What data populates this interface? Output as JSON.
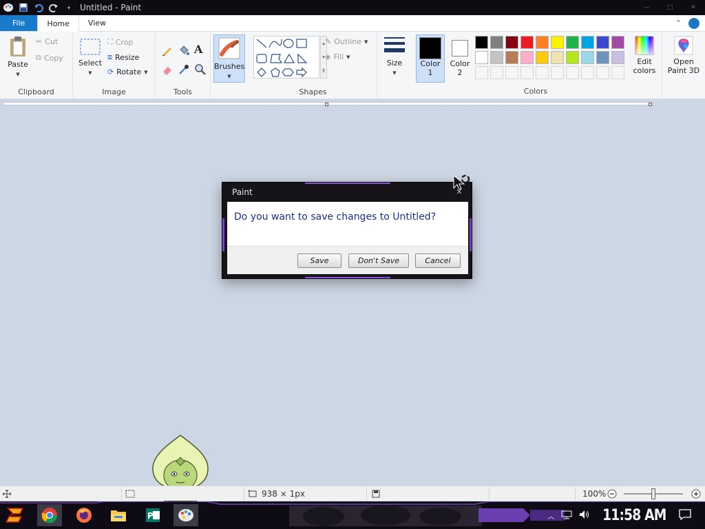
{
  "window": {
    "title": "Untitled - Paint",
    "controls": {
      "minimize": "—",
      "maximize": "□",
      "close": "✕"
    }
  },
  "tabs": {
    "file": "File",
    "home": "Home",
    "view": "View"
  },
  "ribbon": {
    "clipboard": {
      "paste": "Paste",
      "cut": "Cut",
      "copy": "Copy",
      "label": "Clipboard"
    },
    "image": {
      "select": "Select",
      "crop": "Crop",
      "resize": "Resize",
      "rotate": "Rotate",
      "label": "Image"
    },
    "tools": {
      "label": "Tools",
      "text_tool": "A"
    },
    "brushes": {
      "label": "Brushes"
    },
    "shapes": {
      "outline": "Outline",
      "fill": "Fill",
      "label": "Shapes"
    },
    "size": {
      "label": "Size"
    },
    "color1": {
      "line1": "Color",
      "line2": "1",
      "value": "#000000"
    },
    "color2": {
      "line1": "Color",
      "line2": "2",
      "value": "#ffffff"
    },
    "colors": {
      "label": "Colors",
      "palette_row1": [
        "#000000",
        "#7f7f7f",
        "#880015",
        "#ed1c24",
        "#ff7f27",
        "#fff200",
        "#22b14c",
        "#00a2e8",
        "#3f48cc",
        "#a349a4"
      ],
      "palette_row2": [
        "#ffffff",
        "#c3c3c3",
        "#b97a57",
        "#ffaec9",
        "#ffc90e",
        "#efe4b0",
        "#b5e61d",
        "#99d9ea",
        "#7092be",
        "#c8bfe7"
      ]
    },
    "edit_colors": {
      "line1": "Edit",
      "line2": "colors"
    },
    "paint3d": {
      "line1": "Open",
      "line2": "Paint 3D"
    }
  },
  "status": {
    "selection_size": "938 × 1px",
    "zoom": "100%"
  },
  "dialog": {
    "title": "Paint",
    "close": "✕",
    "message": "Do you want to save changes to Untitled?",
    "save": "Save",
    "dont_save": "Don't Save",
    "cancel": "Cancel"
  },
  "taskbar": {
    "clock": "11:58 AM"
  }
}
